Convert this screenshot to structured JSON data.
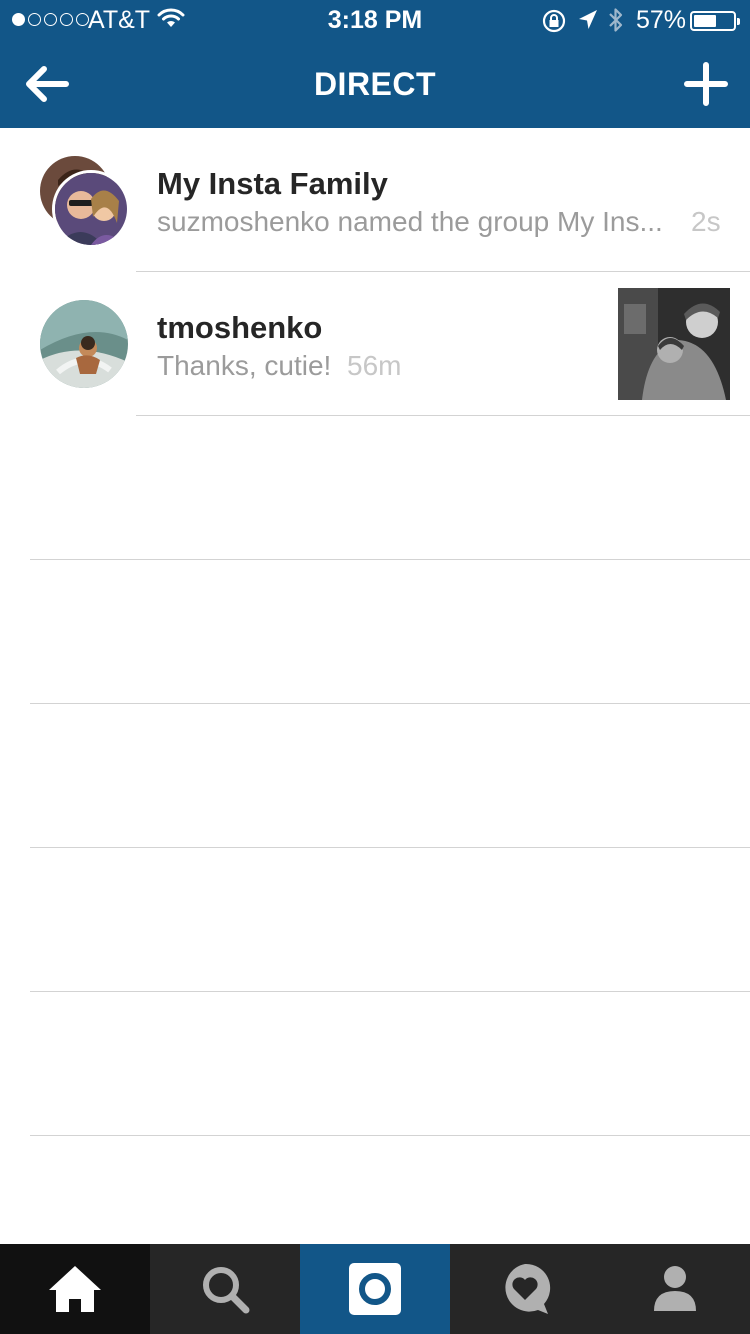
{
  "status_bar": {
    "carrier": "AT&T",
    "signal_bars": 1,
    "time": "3:18 PM",
    "battery_percent": "57%",
    "battery_level": 0.57
  },
  "header": {
    "title": "DIRECT",
    "back_icon": "arrow-left-icon",
    "add_icon": "plus-icon",
    "background": "#125688"
  },
  "threads": [
    {
      "name": "My Insta Family",
      "preview": "suzmoshenko named the group My Ins...",
      "time": "2s",
      "avatar_type": "group"
    },
    {
      "name": "tmoshenko",
      "preview": "Thanks, cutie!",
      "time": "56m",
      "avatar_type": "single",
      "has_media_thumbnail": true
    }
  ],
  "tabbar": {
    "items": [
      "home-icon",
      "search-icon",
      "camera-icon",
      "activity-heart-icon",
      "profile-icon"
    ],
    "active": "camera-icon",
    "active_color": "#125688"
  }
}
